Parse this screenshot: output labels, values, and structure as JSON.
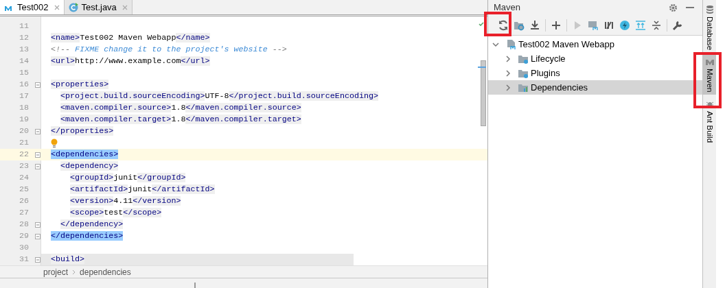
{
  "editor_tabs": [
    {
      "label": "Test002",
      "kind": "maven",
      "selected": true
    },
    {
      "label": "Test.java",
      "kind": "java",
      "selected": false
    }
  ],
  "code_lines": [
    {
      "number": "11"
    },
    {
      "number": "12",
      "tokens": [
        {
          "kind": "tag",
          "text": "  <name>"
        },
        {
          "kind": "text",
          "text": "Test002 Maven Webapp"
        },
        {
          "kind": "tag",
          "text": "</name>"
        }
      ]
    },
    {
      "number": "13",
      "tokens": [
        {
          "kind": "comment-mark",
          "text": "  <!--"
        },
        {
          "kind": "comment",
          "text": " FIXME change it to the project's website "
        },
        {
          "kind": "comment-mark",
          "text": "-->"
        }
      ]
    },
    {
      "number": "14",
      "tokens": [
        {
          "kind": "tag",
          "text": "  <url>"
        },
        {
          "kind": "text",
          "text": "http://www.example.com"
        },
        {
          "kind": "tag",
          "text": "</url>"
        }
      ]
    },
    {
      "number": "15"
    },
    {
      "number": "16",
      "fold": true,
      "tokens": [
        {
          "kind": "tag",
          "text": "  <properties>"
        }
      ]
    },
    {
      "number": "17",
      "tokens": [
        {
          "kind": "tag",
          "text": "    <project.build.sourceEncoding>"
        },
        {
          "kind": "text",
          "text": "UTF-8"
        },
        {
          "kind": "tag",
          "text": "</project.build.sourceEncoding>"
        }
      ]
    },
    {
      "number": "18",
      "tokens": [
        {
          "kind": "tag",
          "text": "    <maven.compiler.source>"
        },
        {
          "kind": "text",
          "text": "1.8"
        },
        {
          "kind": "tag",
          "text": "</maven.compiler.source>"
        }
      ]
    },
    {
      "number": "19",
      "tokens": [
        {
          "kind": "tag",
          "text": "    <maven.compiler.target>"
        },
        {
          "kind": "text",
          "text": "1.8"
        },
        {
          "kind": "tag",
          "text": "</maven.compiler.target>"
        }
      ]
    },
    {
      "number": "20",
      "fold": true,
      "tokens": [
        {
          "kind": "tag",
          "text": "  </properties>"
        }
      ]
    },
    {
      "number": "21",
      "bulb": true
    },
    {
      "number": "22",
      "fold": true,
      "current": true,
      "tokens": [
        {
          "kind": "tag",
          "text": "  <dependencies>",
          "matched": true
        }
      ]
    },
    {
      "number": "23",
      "fold": true,
      "tokens": [
        {
          "kind": "tag",
          "text": "    <dependency>"
        }
      ]
    },
    {
      "number": "24",
      "tokens": [
        {
          "kind": "tag",
          "text": "      <groupId>"
        },
        {
          "kind": "text",
          "text": "junit"
        },
        {
          "kind": "tag",
          "text": "</groupId>"
        }
      ]
    },
    {
      "number": "25",
      "tokens": [
        {
          "kind": "tag",
          "text": "      <artifactId>"
        },
        {
          "kind": "text",
          "text": "junit"
        },
        {
          "kind": "tag",
          "text": "</artifactId>"
        }
      ]
    },
    {
      "number": "26",
      "tokens": [
        {
          "kind": "tag",
          "text": "      <version>"
        },
        {
          "kind": "text",
          "text": "4.11"
        },
        {
          "kind": "tag",
          "text": "</version>"
        }
      ]
    },
    {
      "number": "27",
      "tokens": [
        {
          "kind": "tag",
          "text": "      <scope>"
        },
        {
          "kind": "text",
          "text": "test"
        },
        {
          "kind": "tag",
          "text": "</scope>"
        }
      ]
    },
    {
      "number": "28",
      "fold": true,
      "tokens": [
        {
          "kind": "tag",
          "text": "    </dependency>"
        }
      ]
    },
    {
      "number": "29",
      "fold": true,
      "tokens": [
        {
          "kind": "tag",
          "text": "  </dependencies>",
          "matched": true
        }
      ]
    },
    {
      "number": "30"
    },
    {
      "number": "31",
      "fold": true,
      "shaded": true,
      "tokens": [
        {
          "kind": "tag",
          "text": "  <build>"
        }
      ]
    }
  ],
  "breadcrumbs": [
    "project",
    "dependencies"
  ],
  "maven_panel": {
    "title": "Maven",
    "tree": [
      {
        "label": "Test002 Maven Webapp",
        "kind": "project",
        "expanded": true,
        "selected": false,
        "children": [
          {
            "label": "Lifecycle",
            "kind": "config-folder",
            "expanded": false,
            "selected": false
          },
          {
            "label": "Plugins",
            "kind": "config-folder",
            "expanded": false,
            "selected": false
          },
          {
            "label": "Dependencies",
            "kind": "deps-folder",
            "expanded": false,
            "selected": true
          }
        ]
      }
    ]
  },
  "side_tabs": [
    {
      "label": "Database",
      "kind": "database",
      "selected": false
    },
    {
      "label": "Maven",
      "kind": "maven",
      "selected": true
    },
    {
      "label": "Ant Build",
      "kind": "ant",
      "selected": false
    }
  ]
}
